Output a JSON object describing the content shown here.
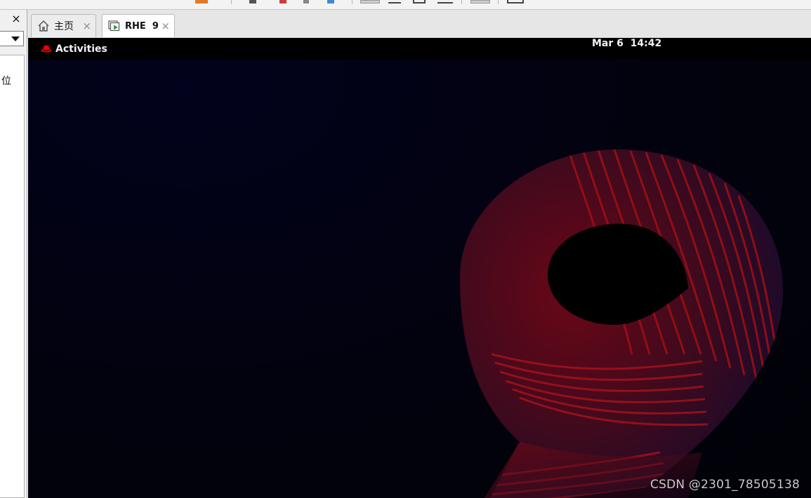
{
  "left_panel": {
    "close_label": "×",
    "list_item": "位"
  },
  "tabs": [
    {
      "label": "主页",
      "icon": "home-icon"
    },
    {
      "label": "RHE  9",
      "icon": "vm-running-icon"
    }
  ],
  "tab_close_label": "×",
  "vm": {
    "activities_label": "Activities",
    "clock": "Mar 6  14:42",
    "wallpaper": "red-hat-9-wallpaper"
  },
  "watermark": "CSDN @2301_78505138",
  "colors": {
    "topbar": "#000000",
    "accent_red": "#c10000",
    "vm_play_green": "#2e9e2e"
  }
}
